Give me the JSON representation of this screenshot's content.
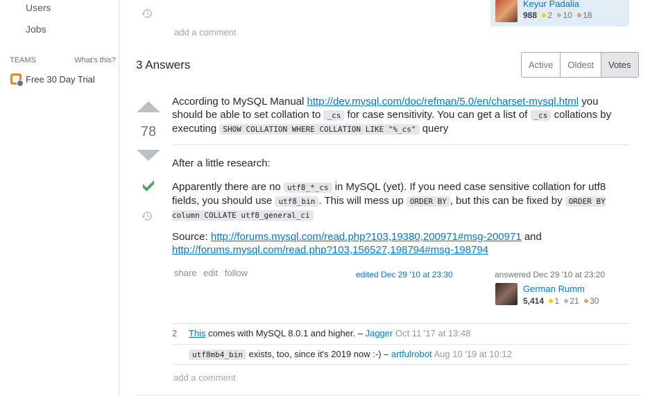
{
  "sidebar": {
    "items": [
      {
        "label": "Users"
      },
      {
        "label": "Jobs"
      }
    ],
    "teams_label": "TEAMS",
    "whats_this": "What's this?",
    "trial_label": "Free 30 Day Trial"
  },
  "question": {
    "add_comment": "add a comment",
    "owner": {
      "name": "Keyur Padalia",
      "rep": "988",
      "gold": "2",
      "silver": "10",
      "bronze": "18"
    }
  },
  "answers": {
    "header": "3 Answers",
    "sort_tabs": [
      {
        "label": "Active"
      },
      {
        "label": "Oldest"
      },
      {
        "label": "Votes"
      }
    ],
    "answer": {
      "votes": "78",
      "p1_a": "According to MySQL Manual ",
      "p1_link": "http://dev.mysql.com/doc/refman/5.0/en/charset-mysql.html",
      "p1_b": " you should be able to set collation to ",
      "p1_code1": "_cs",
      "p1_c": " for case sensitivity. You can get a list of ",
      "p1_code2": "_cs",
      "p1_d": " collations by executing ",
      "p1_code3": "SHOW COLLATION WHERE COLLATION LIKE  \"%_cs\"",
      "p1_e": " query",
      "p2": "After a little research:",
      "p3_a": "Apparently there are no ",
      "p3_code1": "utf8_*_cs",
      "p3_b": " in MySQL (yet). If you need case sensitive collation for utf8 fields, you should use ",
      "p3_code2": "utf8_bin",
      "p3_c": ". This will mess up ",
      "p3_code3": "ORDER BY",
      "p3_d": ", but this can be fixed by ",
      "p3_code4": "ORDER BY column COLLATE utf8_general_ci",
      "p4_a": "Source: ",
      "p4_link1": "http://forums.mysql.com/read.php?103,19380,200971#msg-200971",
      "p4_b": " and ",
      "p4_link2": "http://forums.mysql.com/read.php?103,156527,198794#msg-198794",
      "menu": {
        "share": "share",
        "edit": "edit",
        "follow": "follow"
      },
      "edited": "edited Dec 29 '10 at 23:30",
      "answered": "answered Dec 29 '10 at 23:20",
      "author": {
        "name": "German Rumm",
        "rep": "5,414",
        "gold": "1",
        "silver": "21",
        "bronze": "30"
      },
      "comments": [
        {
          "score": "2",
          "link": "This",
          "text": " comes with MySQL 8.0.1 and higher. – ",
          "user": "Jagger",
          "time": "Oct 11 '17 at 13:48"
        },
        {
          "score": "",
          "code": "utf8mb4_bin",
          "text": " exists, too, since it's 2019 now :-) – ",
          "user": "artfulrobot",
          "time": "Aug 10 '19 at 10:12"
        }
      ],
      "add_comment": "add a comment"
    }
  }
}
